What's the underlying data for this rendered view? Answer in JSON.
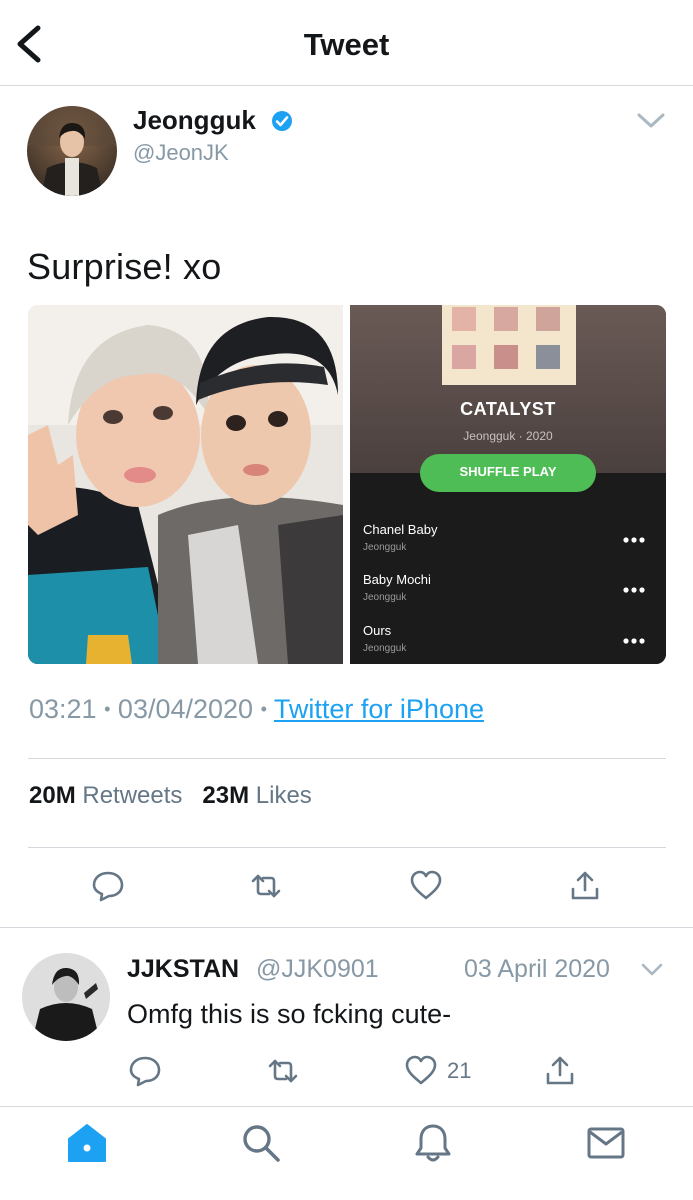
{
  "header": {
    "title": "Tweet"
  },
  "tweet": {
    "author_name": "Jeongguk",
    "author_handle": "@JeonJK",
    "text": "Surprise! xo",
    "time": "03:21",
    "date": "03/04/2020",
    "separator": "•",
    "source": "Twitter for iPhone",
    "retweets_count": "20M",
    "retweets_label": "Retweets",
    "likes_count": "23M",
    "likes_label": "Likes"
  },
  "music_card": {
    "album": "CATALYST",
    "artist_year": "Jeongguk · 2020",
    "shuffle_label": "SHUFFLE PLAY",
    "tracks": [
      {
        "title": "Chanel Baby",
        "artist": "Jeongguk"
      },
      {
        "title": "Baby Mochi",
        "artist": "Jeongguk"
      },
      {
        "title": "Ours",
        "artist": "Jeongguk"
      }
    ]
  },
  "reply": {
    "author_name": "JJKSTAN",
    "author_handle": "@JJK0901",
    "date": "03 April 2020",
    "text": "Omfg this is so fcking cute-",
    "like_count": "21"
  },
  "colors": {
    "accent": "#1da1f2",
    "secondary_text": "#8899a6",
    "shuffle_green": "#4fbd55"
  }
}
